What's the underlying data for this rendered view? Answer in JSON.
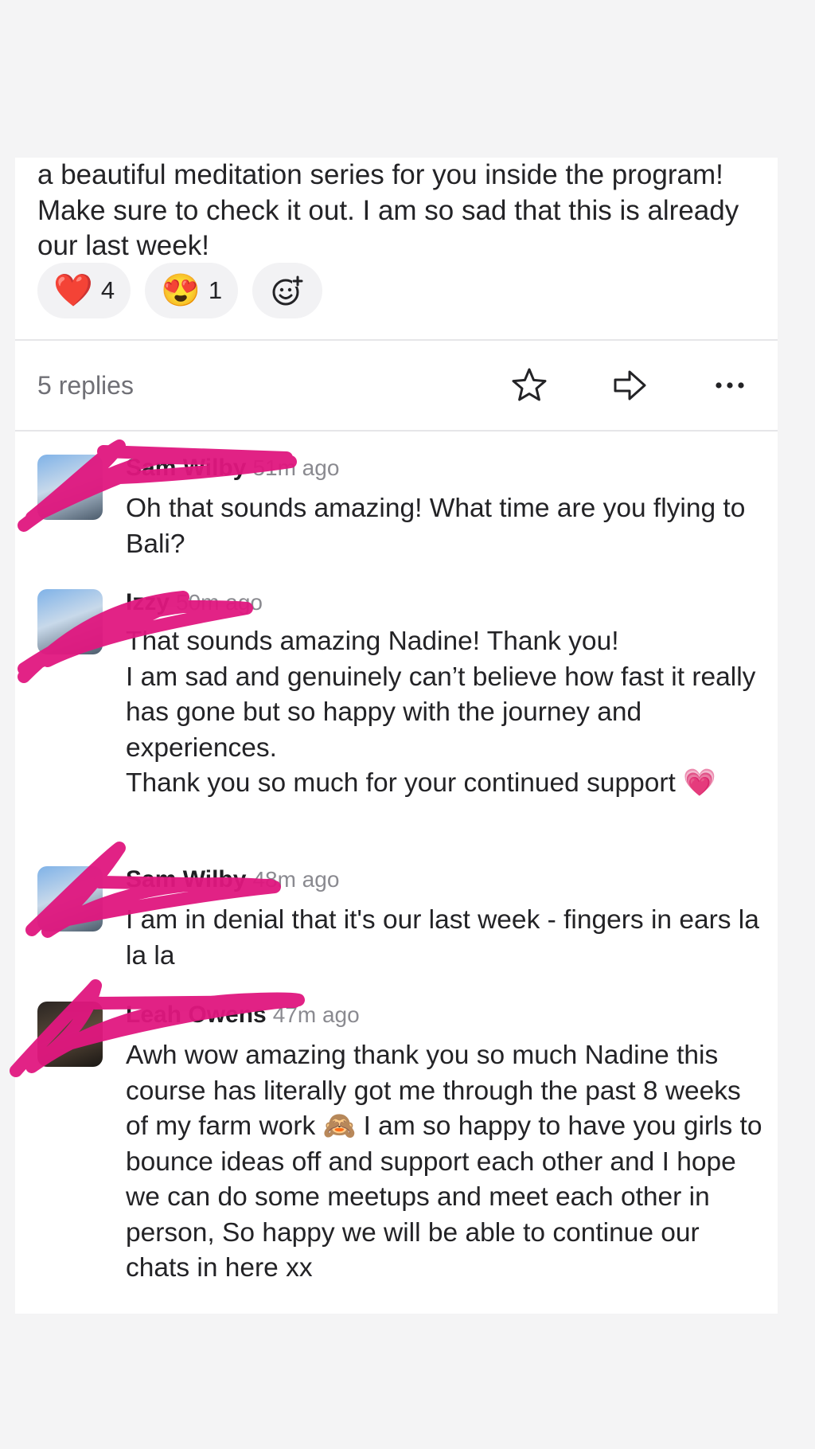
{
  "post": {
    "text": "a beautiful meditation series for you inside the program! Make sure to check it out. I am so sad that this is already our last week!",
    "reactions": [
      {
        "emoji": "❤️",
        "icon": "heart-icon",
        "count": "4"
      },
      {
        "emoji": "😍",
        "icon": "heart-eyes-icon",
        "count": "1"
      }
    ],
    "add_reaction_icon": "add-emoji-icon"
  },
  "thread_bar": {
    "replies_label": "5 replies",
    "icons": [
      "star-icon",
      "share-arrow-icon",
      "more-icon"
    ]
  },
  "replies": [
    {
      "author": "Sam Wilby",
      "time": "51m ago",
      "lines": [
        "Oh that sounds amazing! What time are you flying to Bali?"
      ]
    },
    {
      "author": "Izzy",
      "time": "50m ago",
      "lines": [
        "That sounds amazing Nadine! Thank you!",
        "I am sad and genuinely can’t believe how fast it really has gone but so happy with the journey and experiences.",
        "Thank you so much for your continued support 💗"
      ]
    },
    {
      "author": "Sam Wilby",
      "time": "48m ago",
      "lines": [
        "I am in denial that it's our last week - fingers in ears la la la"
      ]
    },
    {
      "author": "Leah Owens",
      "time": "47m ago",
      "lines": [
        "Awh wow amazing thank you so much Nadine this course has literally got me through the past 8 weeks of my farm work 🙈 I am so happy to have you girls to bounce ideas off and support each other and I hope we can do some meetups and meet each other in person, So happy we will be able to continue our chats in here xx"
      ]
    }
  ],
  "colors": {
    "background": "#f4f4f5",
    "card": "#ffffff",
    "text": "#232326",
    "muted": "#707076",
    "redaction": "#e0177f"
  }
}
